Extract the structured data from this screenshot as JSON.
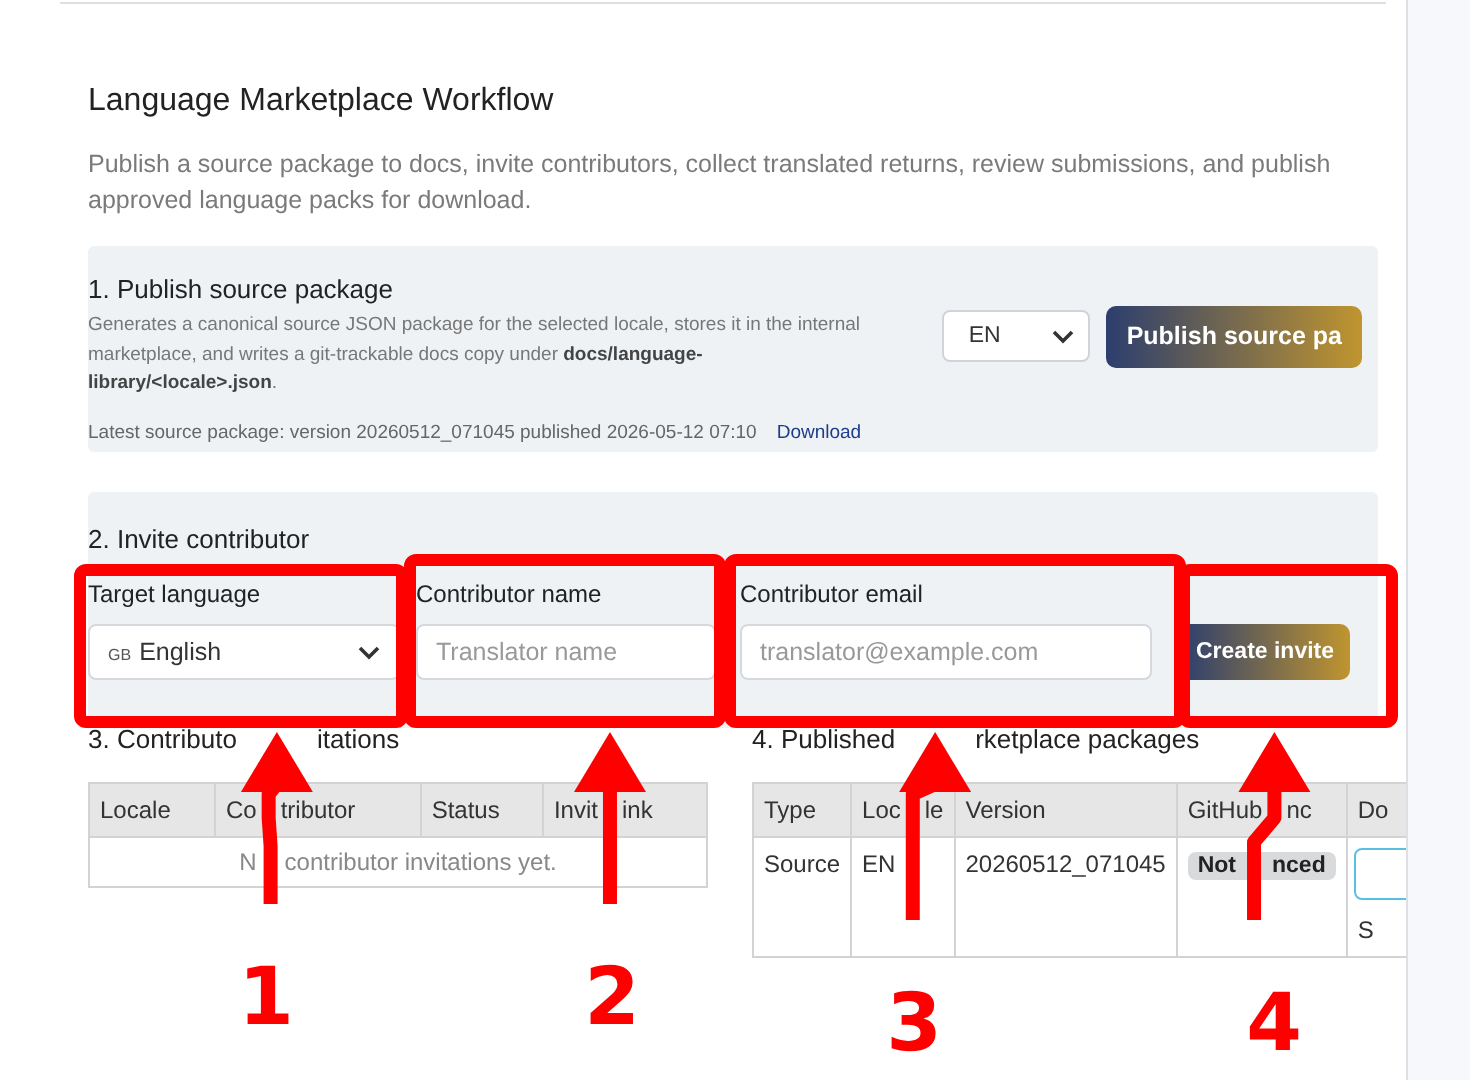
{
  "title": "Language Marketplace Workflow",
  "description": "Publish a source package to docs, invite contributors, collect translated returns, review submissions, and publish approved language packs for download.",
  "publish": {
    "title": "1. Publish source package",
    "text": "Generates a canonical source JSON package for the selected locale, stores it in the internal marketplace, and writes a git-trackable docs copy under **docs/language-library/<locale>.json**.",
    "locale": "EN",
    "button": "Publish source pa",
    "latest": "Latest source package: version 20260512_071045 published 2026-05-12 07:10",
    "link": "Download"
  },
  "invite": {
    "title": "2. Invite contributor",
    "fields": [
      {
        "kind": "select",
        "label": "Target language",
        "flag": "GB",
        "value": "English"
      },
      {
        "kind": "input",
        "label": "Contributor name",
        "placeholder": "Translator name"
      },
      {
        "kind": "input",
        "label": "Contributor email",
        "placeholder": "translator@example.com"
      }
    ],
    "button": "Create invite"
  },
  "invitations": {
    "title": [
      "3. Contributo",
      "itations"
    ],
    "columns": [
      "Locale",
      [
        "Co",
        "tributor"
      ],
      "Status",
      [
        "Invit",
        "ink"
      ]
    ],
    "empty": [
      "N",
      "contributor invitations yet."
    ]
  },
  "packages": {
    "title": [
      "4. Published",
      "rketplace packages"
    ],
    "columns": [
      "Type",
      [
        "Loc",
        "le"
      ],
      "Version",
      [
        "GitHub",
        "nc"
      ],
      "Do"
    ],
    "rows": [
      [
        {
          "kind": "text",
          "text": "Source"
        },
        {
          "kind": "text",
          "text": "EN"
        },
        {
          "kind": "text",
          "text": "20260512_071045"
        },
        {
          "kind": "badge",
          "text": [
            "Not",
            "nced"
          ]
        },
        {
          "kind": "actions",
          "text": "S"
        }
      ]
    ]
  },
  "annotations": [
    {
      "number": "1"
    },
    {
      "number": "2"
    },
    {
      "number": "3"
    },
    {
      "number": "4"
    }
  ]
}
